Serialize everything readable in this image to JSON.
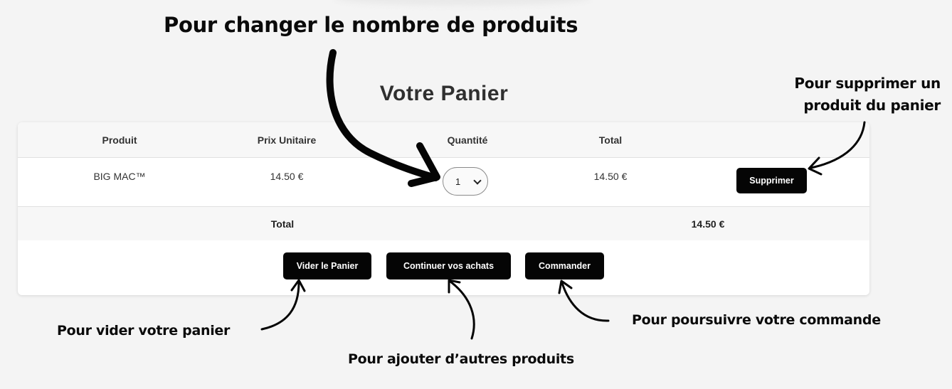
{
  "annotations": {
    "change_quantity": "Pour changer le nombre de produits",
    "remove_product": "Pour supprimer un produit du panier",
    "empty_cart": "Pour vider votre panier",
    "add_products": "Pour ajouter d’autres produits",
    "continue_order": "Pour poursuivre votre commande"
  },
  "cart": {
    "title": "Votre Panier",
    "columns": [
      "Produit",
      "Prix Unitaire",
      "Quantité",
      "Total"
    ],
    "items": [
      {
        "product": "BIG MAC™",
        "unit_price": "14.50 €",
        "quantity": "1",
        "total": "14.50 €",
        "remove_label": "Supprimer"
      }
    ],
    "total_label": "Total",
    "total_value": "14.50 €",
    "buttons": {
      "empty": "Vider le Panier",
      "continue": "Continuer vos achats",
      "order": "Commander"
    }
  },
  "icons": {
    "quantity_dropdown": "chevron-down-icon",
    "annotation_arrows": "hand-drawn-arrow-icon"
  },
  "colors": {
    "background": "#f4f4f4",
    "card": "#ffffff",
    "button": "#050505",
    "button_text": "#ffffff",
    "annotation": "#0a0a0a"
  }
}
